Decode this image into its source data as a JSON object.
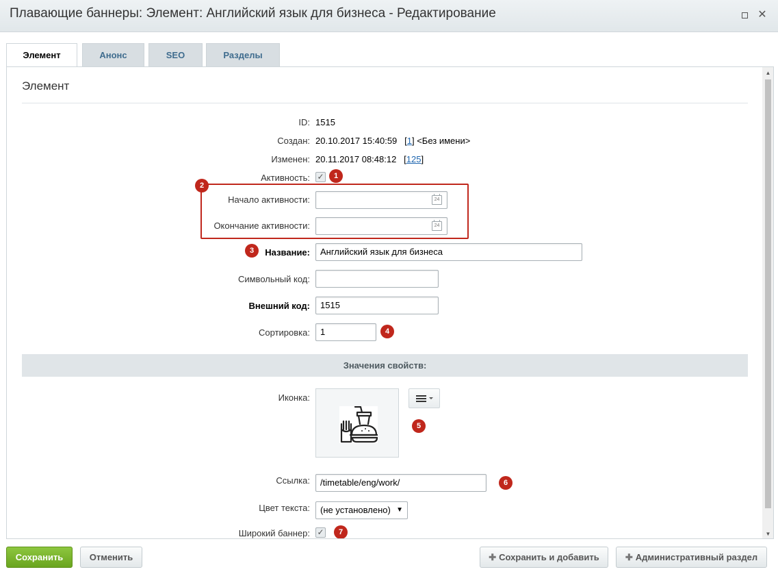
{
  "window": {
    "title": "Плавающие баннеры: Элемент: Английский язык для бизнеса - Редактирование"
  },
  "tabs": [
    {
      "label": "Элемент"
    },
    {
      "label": "Анонс"
    },
    {
      "label": "SEO"
    },
    {
      "label": "Разделы"
    }
  ],
  "section": {
    "title": "Элемент"
  },
  "fields": {
    "id": {
      "label": "ID:",
      "value": "1515"
    },
    "created": {
      "label": "Создан:",
      "value": "20.10.2017 15:40:59",
      "user_id": "1",
      "user_name": "<Без имени>"
    },
    "modified": {
      "label": "Изменен:",
      "value": "20.11.2017 08:48:12",
      "user_id": "125"
    },
    "active": {
      "label": "Активность:",
      "checked": true
    },
    "active_from": {
      "label": "Начало активности:",
      "value": ""
    },
    "active_to": {
      "label": "Окончание активности:",
      "value": ""
    },
    "name": {
      "label": "Название:",
      "value": "Английский язык для бизнеса"
    },
    "code": {
      "label": "Символьный код:",
      "value": ""
    },
    "xml_id": {
      "label": "Внешний код:",
      "value": "1515"
    },
    "sort": {
      "label": "Сортировка:",
      "value": "1"
    }
  },
  "properties": {
    "header": "Значения свойств:",
    "icon": {
      "label": "Иконка:",
      "image": "burger-drink-icon"
    },
    "link": {
      "label": "Ссылка:",
      "value": "/timetable/eng/work/"
    },
    "text_color": {
      "label": "Цвет текста:",
      "selected": "(не установлено)"
    },
    "wide_banner": {
      "label": "Широкий баннер:",
      "checked": true
    }
  },
  "annotations": [
    "1",
    "2",
    "3",
    "4",
    "5",
    "6",
    "7"
  ],
  "buttons": {
    "save": "Сохранить",
    "cancel": "Отменить",
    "save_add": "Сохранить и добавить",
    "admin_section": "Административный раздел"
  },
  "colors": {
    "accent_red": "#c0271c",
    "save_green": "#7ab42f",
    "tab_text": "#3f6c8e",
    "link": "#2067b0"
  }
}
